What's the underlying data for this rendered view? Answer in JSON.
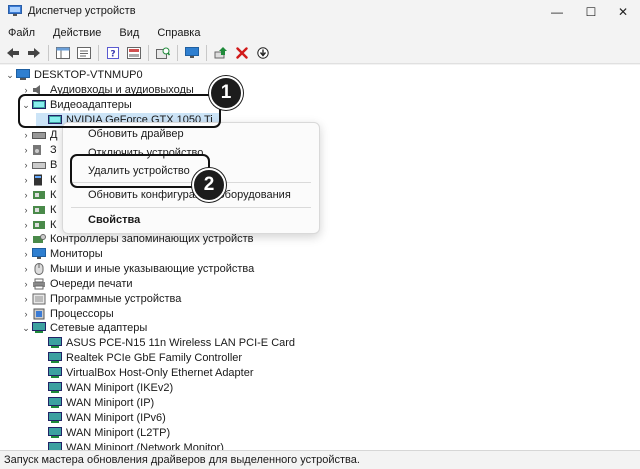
{
  "window": {
    "title": "Диспетчер устройств",
    "minimize_glyph": "—",
    "maximize_glyph": "☐",
    "close_glyph": "✕"
  },
  "menu": [
    "Файл",
    "Действие",
    "Вид",
    "Справка"
  ],
  "tree": {
    "root": "DESKTOP-VTNMUP0",
    "audio_inputs": "Аудиовходы и аудиовыходы",
    "video_adapters": "Видеоадаптеры",
    "gpu": "NVIDIA GeForce GTX 1050 Ti",
    "hidden_letters": [
      "Д",
      "З",
      "В",
      "К",
      "К",
      "К",
      "К"
    ],
    "storage_controllers": "Контроллеры запоминающих устройств",
    "monitors": "Мониторы",
    "mice": "Мыши и иные указывающие устройства",
    "print_queues": "Очереди печати",
    "software_devices": "Программные устройства",
    "processors": "Процессоры",
    "network_adapters": "Сетевые адаптеры",
    "nics": [
      "ASUS PCE-N15 11n Wireless LAN PCI-E Card",
      "Realtek PCIe GbE Family Controller",
      "VirtualBox Host-Only Ethernet Adapter",
      "WAN Miniport (IKEv2)",
      "WAN Miniport (IP)",
      "WAN Miniport (IPv6)",
      "WAN Miniport (L2TP)",
      "WAN Miniport (Network Monitor)"
    ]
  },
  "context_menu": {
    "update_driver": "Обновить драйвер",
    "disable_device": "Отключить устройство",
    "uninstall_device": "Удалить устройство",
    "scan_hardware": "Обновить конфигурацию оборудования",
    "properties": "Свойства"
  },
  "badges": {
    "first": "1",
    "second": "2"
  },
  "status": "Запуск мастера обновления драйверов для выделенного устройства.",
  "colors": {
    "accent": "#0067c0",
    "selection": "#cce4f7",
    "delete_red": "#d11a1a",
    "green": "#1f8a3a"
  }
}
